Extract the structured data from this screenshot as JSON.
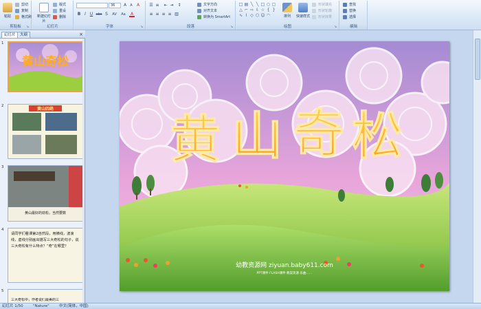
{
  "ribbon": {
    "clipboard": {
      "label": "剪贴板",
      "paste": "粘贴",
      "cut": "剪切",
      "copy": "复制",
      "format_painter": "格式刷"
    },
    "slides": {
      "label": "幻灯片",
      "new_slide": "新建幻灯片",
      "layout": "版式",
      "reset": "重设",
      "delete": "删除"
    },
    "font": {
      "label": "字体",
      "font_name": "",
      "font_size": "36",
      "bold": "B",
      "italic": "I",
      "underline": "U",
      "strike": "abc",
      "shadow": "S",
      "spacing": "AV",
      "case": "Aa",
      "color": "A",
      "grow": "A",
      "shrink": "A",
      "clear": "A"
    },
    "paragraph": {
      "label": "段落",
      "text_direction": "文字方向",
      "align_text": "对齐文本",
      "smartart": "转换为 SmartArt"
    },
    "drawing": {
      "label": "绘图",
      "arrange": "排列",
      "quick_styles": "快速样式",
      "fill": "形状填充",
      "outline": "形状轮廓",
      "effects": "形状效果"
    },
    "editing": {
      "label": "编辑",
      "find": "查找",
      "replace": "替换",
      "select": "选择"
    }
  },
  "pane": {
    "tabs": [
      "幻灯片",
      "大纲"
    ],
    "close": "×",
    "slides": [
      {
        "num": "1",
        "title": "黄山奇松"
      },
      {
        "num": "2",
        "title": "黄山四绝"
      },
      {
        "num": "3",
        "caption": "黄山最好的劲松，当然要数"
      },
      {
        "num": "4",
        "text": "请同学们看课第2自然段，用横线，波浪线，虚线分别画出描写三大奇松的句子，说三大奇松有什么特点？“奇”在哪里？"
      },
      {
        "num": "5",
        "text": "三大奇松中，作者说们最美的三"
      }
    ]
  },
  "slide": {
    "title_chars": [
      "黄",
      "山",
      "奇",
      "松"
    ],
    "watermark": "幼教资源网 ziyuan.baby611.com",
    "watermark_small": "PPT课件 FLASH课件 教案资源 乐曲……"
  },
  "status": {
    "page": "幻灯片 1/50",
    "theme": "\"Nature\"",
    "language": "中文(简体，中国)"
  },
  "colors": {
    "ribbon_bg": "#dbe8f7",
    "title_orange": "#ffb020",
    "sky_top": "#a88ed6",
    "sky_bottom": "#f0a6d8",
    "grass": "#9ccf3f",
    "selected_border": "#f0a33a"
  }
}
